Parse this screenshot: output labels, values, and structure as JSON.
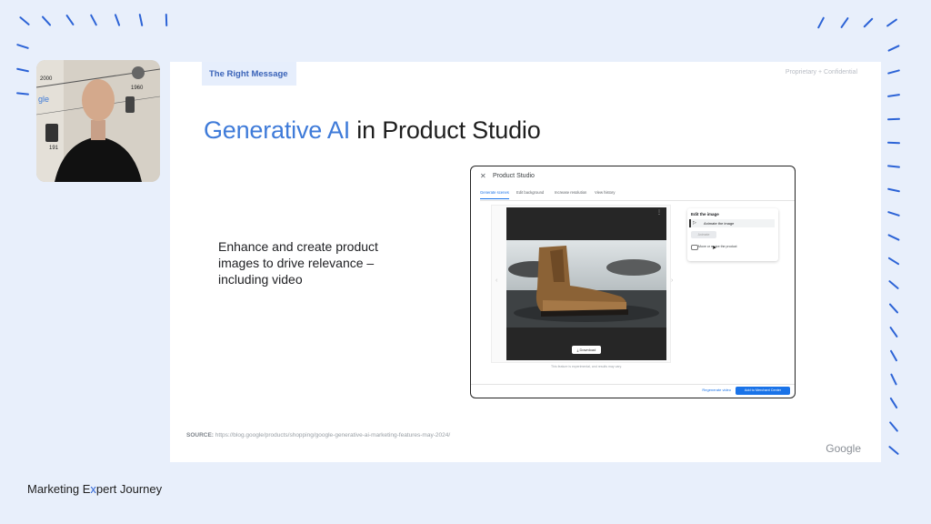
{
  "slide": {
    "section_tag": "The Right Message",
    "confidential": "Proprietary + Confidential",
    "title_highlight": "Generative AI",
    "title_rest": " in Product Studio",
    "body": "Enhance and create product images to drive relevance – including video",
    "source_label": "SOURCE:",
    "source_url": " https://blog.google/products/shopping/google-generative-ai-marketing-features-may-2024/",
    "logo": "Google"
  },
  "product_studio": {
    "close": "✕",
    "title": "Product Studio",
    "tabs": [
      "Generate scenes",
      "Edit background",
      "Increase resolution",
      "View history"
    ],
    "active_tab": 0,
    "preview_menu": "⋮",
    "download": "⤓ Download",
    "nav_prev": "‹",
    "nav_next": "›",
    "disclaimer": "This feature is experimental, and results may vary.",
    "edit_panel": {
      "heading": "Edit the image",
      "animate": "Animate the image",
      "animate_button": "Animate",
      "move_label": "Move or resize the product"
    },
    "regenerate": "Regenerate video",
    "add_to_merchant_center": "Add to Merchant Center"
  },
  "webcam": {
    "wall_labels": [
      "2000",
      "1960",
      "gle",
      "191"
    ]
  },
  "footer": {
    "brand_before": "Marketing E",
    "brand_x": "x",
    "brand_after": "pert Journey"
  },
  "colors": {
    "accent": "#1a73e8",
    "dashes": "#2c63d6",
    "background": "#e8effb"
  }
}
